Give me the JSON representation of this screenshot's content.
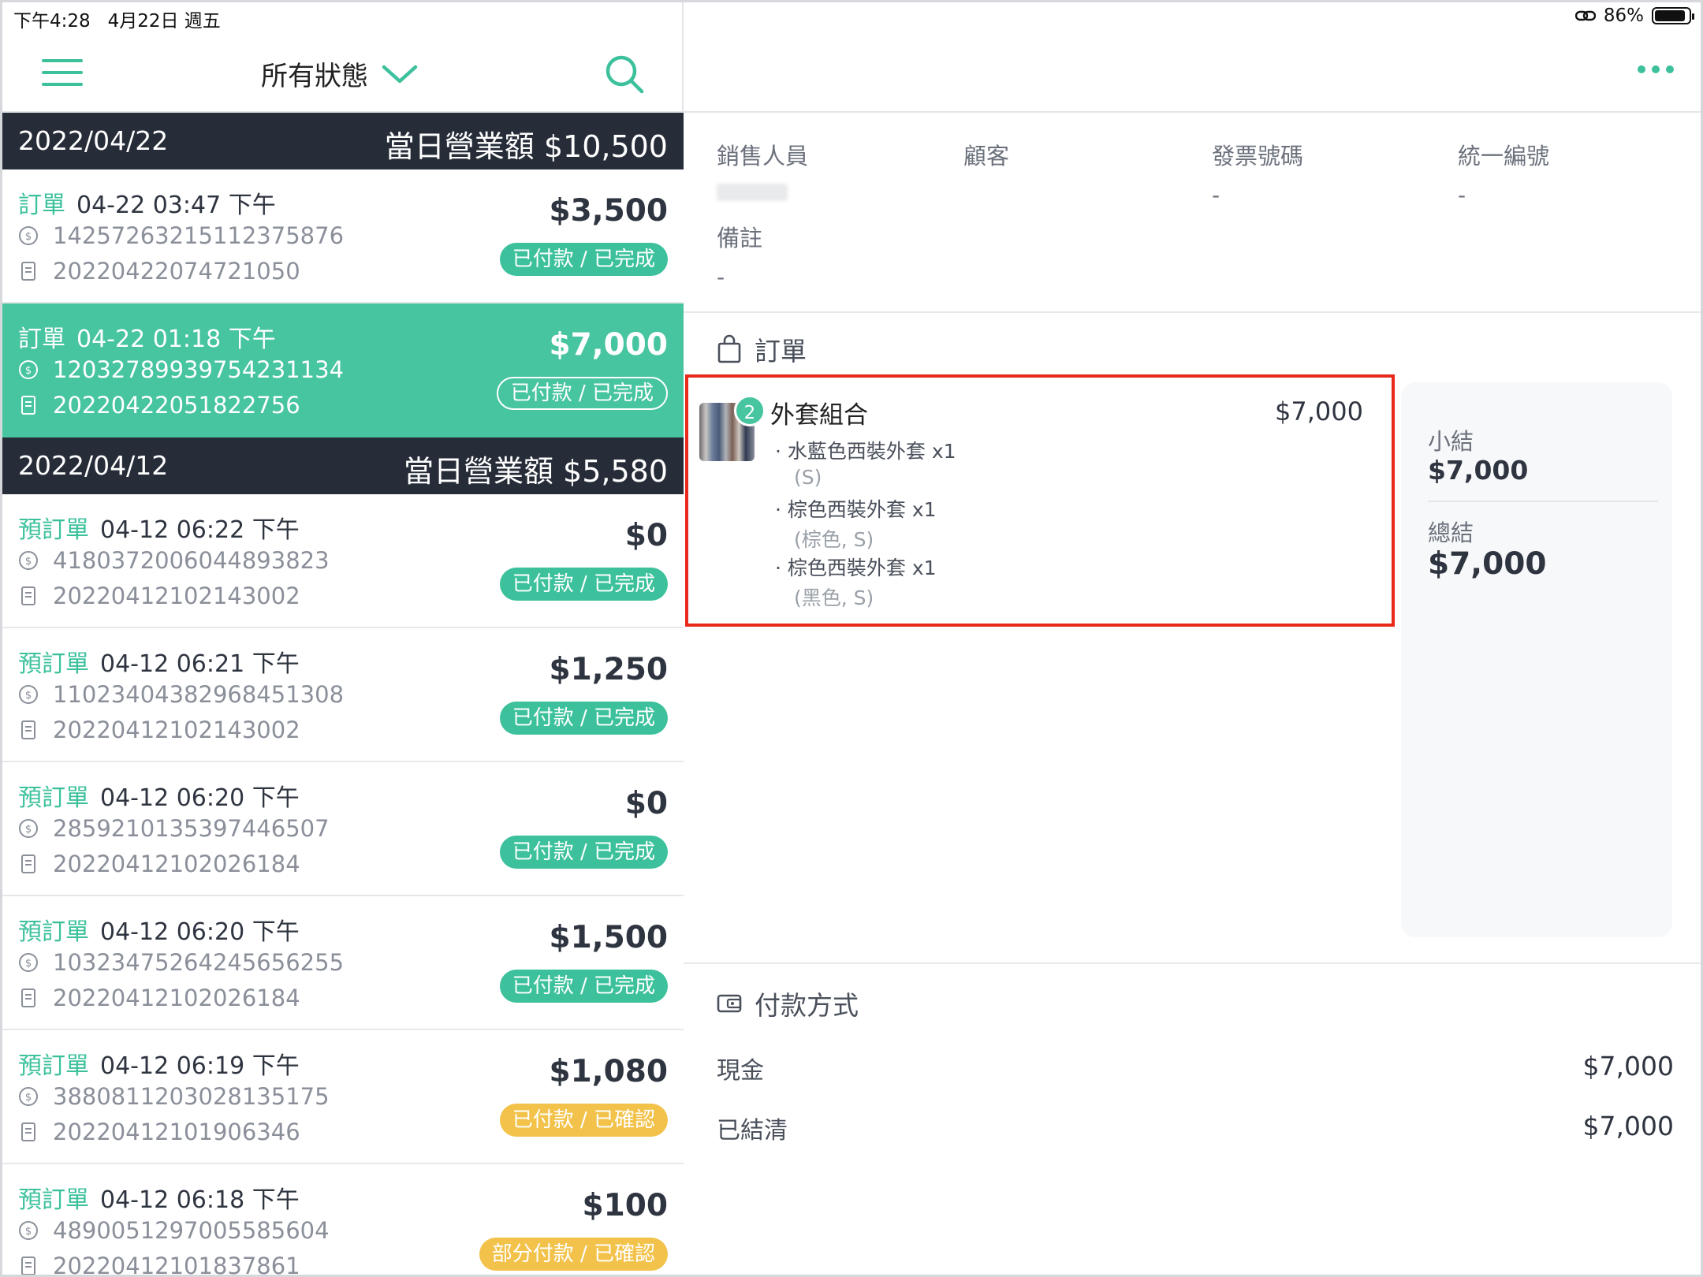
{
  "status_bar": {
    "time": "下午4:28",
    "date": "4月22日 週五",
    "battery": "86%"
  },
  "left_header": {
    "filter_label": "所有狀態"
  },
  "groups": [
    {
      "date": "2022/04/22",
      "revenue": "當日營業額 $10,500",
      "orders": [
        {
          "type": "訂單",
          "datetime": "04-22 03:47 下午",
          "txn_id": "14257263215112375876",
          "order_no": "20220422074721050",
          "amount": "$3,500",
          "status": "已付款 / 已完成",
          "status_color": "#3cc19c",
          "selected": false
        },
        {
          "type": "訂單",
          "datetime": "04-22 01:18 下午",
          "txn_id": "12032789939754231134",
          "order_no": "20220422051822756",
          "amount": "$7,000",
          "status": "已付款 / 已完成",
          "status_color": "#3cc19c",
          "selected": true
        }
      ]
    },
    {
      "date": "2022/04/12",
      "revenue": "當日營業額 $5,580",
      "orders": [
        {
          "type": "預訂單",
          "datetime": "04-12 06:22 下午",
          "txn_id": "4180372006044893823",
          "order_no": "20220412102143002",
          "amount": "$0",
          "status": "已付款 / 已完成",
          "status_color": "#3cc19c",
          "selected": false
        },
        {
          "type": "預訂單",
          "datetime": "04-12 06:21 下午",
          "txn_id": "11023404382968451308",
          "order_no": "20220412102143002",
          "amount": "$1,250",
          "status": "已付款 / 已完成",
          "status_color": "#3cc19c",
          "selected": false
        },
        {
          "type": "預訂單",
          "datetime": "04-12 06:20 下午",
          "txn_id": "2859210135397446507",
          "order_no": "20220412102026184",
          "amount": "$0",
          "status": "已付款 / 已完成",
          "status_color": "#3cc19c",
          "selected": false
        },
        {
          "type": "預訂單",
          "datetime": "04-12 06:20 下午",
          "txn_id": "10323475264245656255",
          "order_no": "20220412102026184",
          "amount": "$1,500",
          "status": "已付款 / 已完成",
          "status_color": "#3cc19c",
          "selected": false
        },
        {
          "type": "預訂單",
          "datetime": "04-12 06:19 下午",
          "txn_id": "3880811203028135175",
          "order_no": "20220412101906346",
          "amount": "$1,080",
          "status": "已付款 / 已確認",
          "status_color": "#f2c24a",
          "selected": false
        },
        {
          "type": "預訂單",
          "datetime": "04-12 06:18 下午",
          "txn_id": "4890051297005585604",
          "order_no": "20220412101837861",
          "amount": "$100",
          "status": "部分付款 / 已確認",
          "status_color": "#f2c24a",
          "selected": false
        }
      ]
    }
  ],
  "detail": {
    "info": {
      "sales_label": "銷售人員",
      "customer_label": "顧客",
      "invoice_label": "發票號碼",
      "invoice_value": "-",
      "tax_id_label": "統一編號",
      "tax_id_value": "-",
      "note_label": "備註",
      "note_value": "-"
    },
    "order_section_title": "訂單",
    "item": {
      "qty": "2",
      "name": "外套組合",
      "price": "$7,000",
      "subitems": [
        {
          "name": "· 水藍色西裝外套 x1",
          "option": "(S)"
        },
        {
          "name": "· 棕色西裝外套 x1",
          "option": "(棕色, S)"
        },
        {
          "name": "· 棕色西裝外套 x1",
          "option": "(黑色, S)"
        }
      ]
    },
    "summary": {
      "subtotal_label": "小結",
      "subtotal_value": "$7,000",
      "total_label": "總結",
      "total_value": "$7,000"
    },
    "payment": {
      "title": "付款方式",
      "rows": [
        {
          "label": "現金",
          "value": "$7,000"
        },
        {
          "label": "已結清",
          "value": "$7,000"
        }
      ]
    }
  },
  "colors": {
    "accent": "#3cc19c",
    "dark": "#262c38",
    "highlight": "#e8291c",
    "warning": "#f2c24a"
  }
}
